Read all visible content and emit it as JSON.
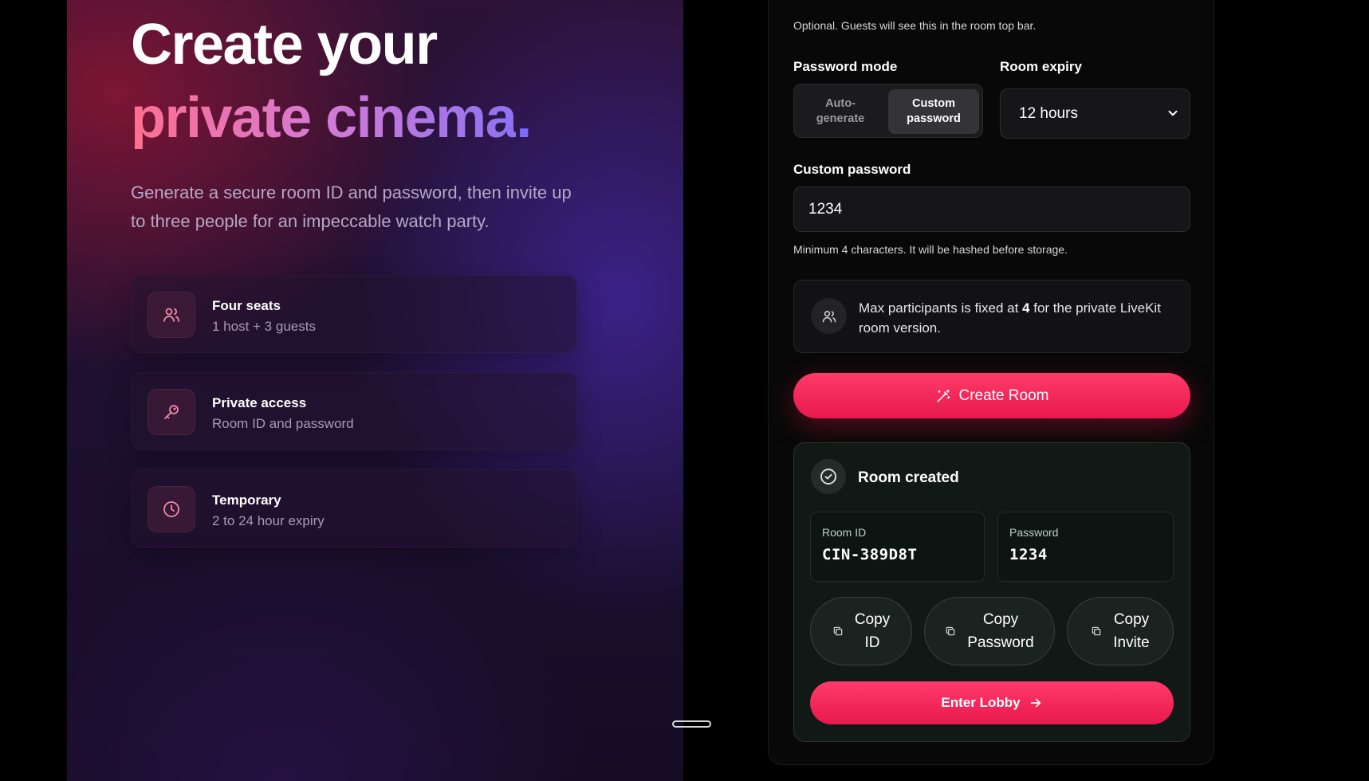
{
  "hero": {
    "line1": "Create your",
    "line2": "private cinema",
    "line2_dot": ".",
    "subtitle": "Generate a secure room ID and password, then invite up to three people for an impeccable watch party."
  },
  "features": [
    {
      "icon": "users-icon",
      "title": "Four seats",
      "subtitle": "1 host + 3 guests"
    },
    {
      "icon": "key-icon",
      "title": "Private access",
      "subtitle": "Room ID and password"
    },
    {
      "icon": "clock-icon",
      "title": "Temporary",
      "subtitle": "2 to 24 hour expiry"
    }
  ],
  "form": {
    "room_name_help": "Optional. Guests will see this in the room top bar.",
    "password_mode": {
      "label": "Password mode",
      "options": [
        "Auto-\ngenerate",
        "Custom\npassword"
      ],
      "selected": "Custom password"
    },
    "room_expiry": {
      "label": "Room expiry",
      "value": "12 hours"
    },
    "custom_password": {
      "label": "Custom password",
      "value": "1234",
      "help": "Minimum 4 characters. It will be hashed before storage."
    },
    "info": {
      "text_before": "Max participants is fixed at ",
      "count": "4",
      "text_after": " for the private LiveKit room version."
    },
    "create_button": "Create Room"
  },
  "room_created": {
    "title": "Room created",
    "room_id_label": "Room ID",
    "room_id": "CIN-389D8T",
    "password_label": "Password",
    "password": "1234",
    "copy_id": "Copy\nID",
    "copy_password": "Copy\nPassword",
    "copy_invite": "Copy\nInvite",
    "enter_lobby": "Enter Lobby"
  },
  "colors": {
    "accent": "#e8184d",
    "hero_gradient_start": "#ff6f8f",
    "hero_gradient_end": "#8d72f2",
    "panel_bg": "#080808"
  }
}
